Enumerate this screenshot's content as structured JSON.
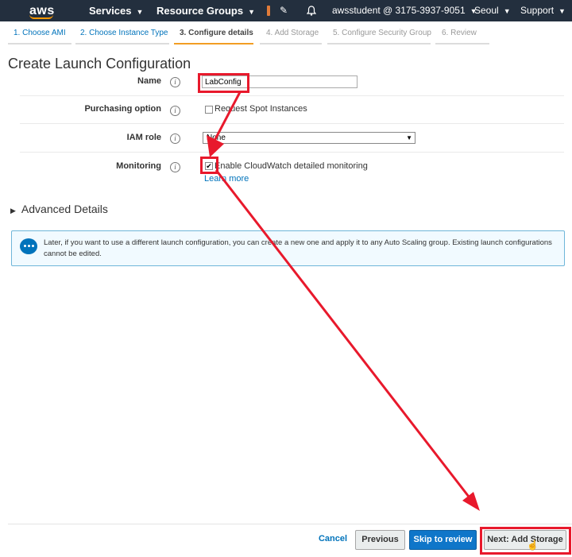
{
  "nav": {
    "logo": "aws",
    "services": "Services",
    "resource_groups": "Resource Groups",
    "account": "awsstudent @ 3175-3937-9051",
    "region": "Seoul",
    "support": "Support"
  },
  "steps": [
    {
      "label": "1. Choose AMI"
    },
    {
      "label": "2. Choose Instance Type"
    },
    {
      "label": "3. Configure details"
    },
    {
      "label": "4. Add Storage"
    },
    {
      "label": "5. Configure Security Group"
    },
    {
      "label": "6. Review"
    }
  ],
  "page_title": "Create Launch Configuration",
  "form": {
    "name_label": "Name",
    "name_value": "LabConfig",
    "purchasing_label": "Purchasing option",
    "spot_label": "Request Spot Instances",
    "iam_label": "IAM role",
    "iam_value": "None",
    "monitoring_label": "Monitoring",
    "monitoring_checkbox": "Enable CloudWatch detailed monitoring",
    "learn_more": "Learn more"
  },
  "advanced_details": "Advanced Details",
  "info_message": "Later, if you want to use a different launch configuration, you can create a new one and apply it to any Auto Scaling group. Existing launch configurations cannot be edited.",
  "footer": {
    "cancel": "Cancel",
    "previous": "Previous",
    "skip": "Skip to review",
    "next": "Next: Add Storage"
  },
  "colors": {
    "nav_bg": "#232f3e",
    "link": "#0073bb",
    "primary_button": "#0f76c9",
    "annotation_red": "#e8192c",
    "active_step_underline": "#f29e24"
  },
  "icons": [
    "bell-icon",
    "pin-icon",
    "info-icon",
    "chat-icon",
    "caret-down-icon",
    "triangle-right-icon",
    "cursor-hand-icon"
  ]
}
